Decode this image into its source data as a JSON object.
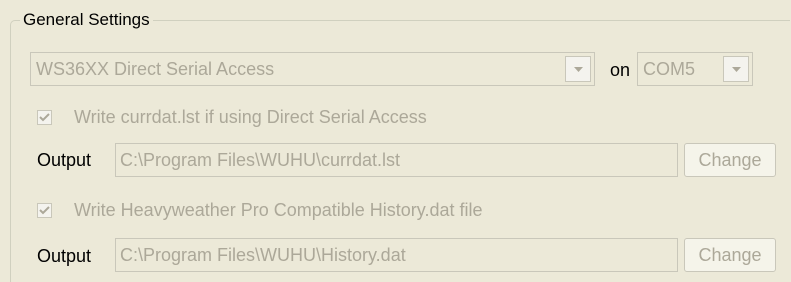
{
  "group": {
    "title": "General Settings"
  },
  "access": {
    "device_value": "WS36XX Direct Serial Access",
    "on_label": "on",
    "port_value": "COM5"
  },
  "currdat": {
    "checkbox_label": "Write currdat.lst if using Direct Serial Access",
    "checked": true,
    "output_label": "Output",
    "path": "C:\\Program Files\\WUHU\\currdat.lst",
    "change_label": "Change"
  },
  "history": {
    "checkbox_label": "Write Heavyweather Pro Compatible History.dat file",
    "checked": true,
    "output_label": "Output",
    "path": "C:\\Program Files\\WUHU\\History.dat",
    "change_label": "Change"
  },
  "icons": {
    "dropdown": "chevron-down-icon",
    "check": "check-icon"
  },
  "colors": {
    "background": "#ece9d8",
    "disabled_text": "#aca899",
    "disabled_border": "#c9c7ba"
  }
}
